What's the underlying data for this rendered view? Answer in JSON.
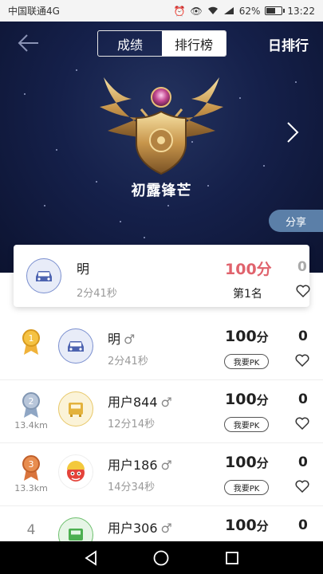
{
  "status_bar": {
    "carrier": "中国联通4G",
    "network": "4G",
    "battery": "62%",
    "battery_level": 0.62,
    "time": "13:22"
  },
  "header": {
    "tabs": [
      {
        "label": "成绩",
        "active": false
      },
      {
        "label": "排行榜",
        "active": true
      }
    ],
    "right_label": "日排行"
  },
  "badge": {
    "title": "初露锋芒",
    "share_label": "分享"
  },
  "my_card": {
    "name": "明",
    "time": "2分41秒",
    "score": "100分",
    "likes": "0",
    "rank": "第1名",
    "avatar_icon": "car-icon"
  },
  "rankings": [
    {
      "rank": "1",
      "medal": "gold",
      "distance": "",
      "name": "明",
      "gender": "♂",
      "time": "2分41秒",
      "score": "100",
      "unit": "分",
      "pk": "我要PK",
      "likes": "0",
      "avatar": "car-icon"
    },
    {
      "rank": "2",
      "medal": "silver",
      "distance": "13.4km",
      "name": "用户844",
      "gender": "♂",
      "time": "12分14秒",
      "score": "100",
      "unit": "分",
      "pk": "我要PK",
      "likes": "0",
      "avatar": "car-icon"
    },
    {
      "rank": "3",
      "medal": "bronze",
      "distance": "13.3km",
      "name": "用户186",
      "gender": "♂",
      "time": "14分34秒",
      "score": "100",
      "unit": "分",
      "pk": "我要PK",
      "likes": "0",
      "avatar": "cartoon-icon"
    },
    {
      "rank": "4",
      "medal": "",
      "distance": "",
      "name": "用户306",
      "gender": "♂",
      "time": "",
      "score": "100",
      "unit": "分",
      "pk": "",
      "likes": "0",
      "avatar": "car-icon"
    }
  ],
  "colors": {
    "accent_score": "#e0636d",
    "hero_bg": "#15204a",
    "share_bg": "#5b7fa8"
  }
}
